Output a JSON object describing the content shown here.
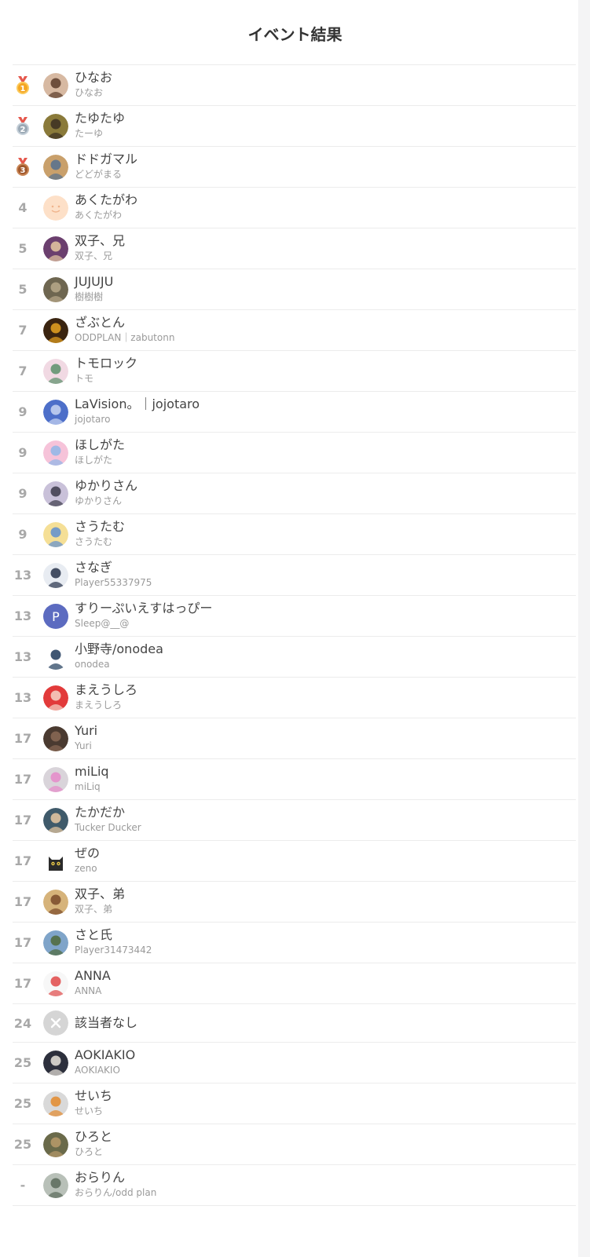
{
  "title": "イベント結果",
  "rows": [
    {
      "rank": "1",
      "medal": "gold",
      "name": "ひなお",
      "sub": "ひなお",
      "avatar": {
        "kind": "photo",
        "bg": "#d7b9a2",
        "fg": "#5a3b2a"
      }
    },
    {
      "rank": "2",
      "medal": "silver",
      "name": "たゆたゆ",
      "sub": "たーゆ",
      "avatar": {
        "kind": "photo",
        "bg": "#8a7a3a",
        "fg": "#3b2f22"
      }
    },
    {
      "rank": "3",
      "medal": "bronze",
      "name": "ドドガマル",
      "sub": "どどがまる",
      "avatar": {
        "kind": "photo",
        "bg": "#c9a06b",
        "fg": "#55708f"
      }
    },
    {
      "rank": "4",
      "medal": "",
      "name": "あくたがわ",
      "sub": "あくたがわ",
      "avatar": {
        "kind": "smile",
        "bg": "#fde0c8",
        "fg": "#f0b48c"
      }
    },
    {
      "rank": "5",
      "medal": "",
      "name": "双子、兄",
      "sub": "双子、兄",
      "avatar": {
        "kind": "photo",
        "bg": "#6b3f6e",
        "fg": "#e6c9a2"
      }
    },
    {
      "rank": "5",
      "medal": "",
      "name": "JUJUJU",
      "sub": "樹樹樹",
      "avatar": {
        "kind": "photo",
        "bg": "#6e6650",
        "fg": "#b9a98a"
      }
    },
    {
      "rank": "7",
      "medal": "",
      "name": "ざぶとん",
      "sub": "ODDPLAN｜zabutonn",
      "avatar": {
        "kind": "photo",
        "bg": "#3a2410",
        "fg": "#e7a321"
      }
    },
    {
      "rank": "7",
      "medal": "",
      "name": "トモロック",
      "sub": "トモ",
      "avatar": {
        "kind": "photo",
        "bg": "#f1d9e3",
        "fg": "#5a8f6a"
      }
    },
    {
      "rank": "9",
      "medal": "",
      "name": "LaVision。｜jojotaro",
      "sub": "jojotaro",
      "avatar": {
        "kind": "photo",
        "bg": "#4d6fc9",
        "fg": "#c9d6f2"
      }
    },
    {
      "rank": "9",
      "medal": "",
      "name": "ほしがた",
      "sub": "ほしがた",
      "avatar": {
        "kind": "photo",
        "bg": "#f6c3d9",
        "fg": "#8fb7e8"
      }
    },
    {
      "rank": "9",
      "medal": "",
      "name": "ゆかりさん",
      "sub": "ゆかりさん",
      "avatar": {
        "kind": "photo",
        "bg": "#c9c1d9",
        "fg": "#3c3a4a"
      }
    },
    {
      "rank": "9",
      "medal": "",
      "name": "さうたむ",
      "sub": "さうたむ",
      "avatar": {
        "kind": "photo",
        "bg": "#f5df96",
        "fg": "#5f8fd0"
      }
    },
    {
      "rank": "13",
      "medal": "",
      "name": "さなぎ",
      "sub": "Player55337975",
      "avatar": {
        "kind": "photo",
        "bg": "#e8ecf2",
        "fg": "#27324a"
      }
    },
    {
      "rank": "13",
      "medal": "",
      "name": "すりーぷいえすはっぴー",
      "sub": "Sleep@__@",
      "avatar": {
        "kind": "letter",
        "letter": "P",
        "bg": "#5c6bc0",
        "fg": "#ffffff"
      }
    },
    {
      "rank": "13",
      "medal": "",
      "name": "小野寺/onodea",
      "sub": "onodea",
      "avatar": {
        "kind": "photo",
        "bg": "#ffffff",
        "fg": "#1e3a5a"
      }
    },
    {
      "rank": "13",
      "medal": "",
      "name": "まえうしろ",
      "sub": "まえうしろ",
      "avatar": {
        "kind": "photo",
        "bg": "#e23a3a",
        "fg": "#f6d6c8"
      }
    },
    {
      "rank": "17",
      "medal": "",
      "name": "Yuri",
      "sub": "Yuri",
      "avatar": {
        "kind": "photo",
        "bg": "#4a3a30",
        "fg": "#8a6a55"
      }
    },
    {
      "rank": "17",
      "medal": "",
      "name": "miLiq",
      "sub": "miLiq",
      "avatar": {
        "kind": "photo",
        "bg": "#d9d4da",
        "fg": "#e58ac9"
      }
    },
    {
      "rank": "17",
      "medal": "",
      "name": "たかだか",
      "sub": "Tucker Ducker",
      "avatar": {
        "kind": "photo",
        "bg": "#3f5a6a",
        "fg": "#e9c9a2"
      }
    },
    {
      "rank": "17",
      "medal": "",
      "name": "ぜの",
      "sub": "zeno",
      "avatar": {
        "kind": "cat",
        "bg": "#ffffff",
        "fg": "#2a2a2a"
      }
    },
    {
      "rank": "17",
      "medal": "",
      "name": "双子、弟",
      "sub": "双子、弟",
      "avatar": {
        "kind": "photo",
        "bg": "#d6b37a",
        "fg": "#7a4a2a"
      }
    },
    {
      "rank": "17",
      "medal": "",
      "name": "さと氏",
      "sub": "Player31473442",
      "avatar": {
        "kind": "photo",
        "bg": "#7fa4c9",
        "fg": "#4f6a3a"
      }
    },
    {
      "rank": "17",
      "medal": "",
      "name": "ANNA",
      "sub": "ANNA",
      "avatar": {
        "kind": "photo",
        "bg": "#f7f7f7",
        "fg": "#e04848"
      }
    },
    {
      "rank": "24",
      "medal": "",
      "name": "該当者なし",
      "sub": "",
      "single": true,
      "avatar": {
        "kind": "none",
        "bg": "#d5d5d5",
        "fg": "#ffffff"
      }
    },
    {
      "rank": "25",
      "medal": "",
      "name": "AOKIAKIO",
      "sub": "AOKIAKIO",
      "avatar": {
        "kind": "photo",
        "bg": "#2c2f3c",
        "fg": "#e9e4dc"
      }
    },
    {
      "rank": "25",
      "medal": "",
      "name": "せいち",
      "sub": "せいち",
      "avatar": {
        "kind": "photo",
        "bg": "#d9d9d9",
        "fg": "#e3892c"
      }
    },
    {
      "rank": "25",
      "medal": "",
      "name": "ひろと",
      "sub": "ひろと",
      "avatar": {
        "kind": "photo",
        "bg": "#6a6a4a",
        "fg": "#b89a6a"
      }
    },
    {
      "rank": "-",
      "medal": "",
      "name": "おらりん",
      "sub": "おらりん/odd plan",
      "avatar": {
        "kind": "photo",
        "bg": "#b8c0b8",
        "fg": "#5a6a5a"
      }
    }
  ]
}
